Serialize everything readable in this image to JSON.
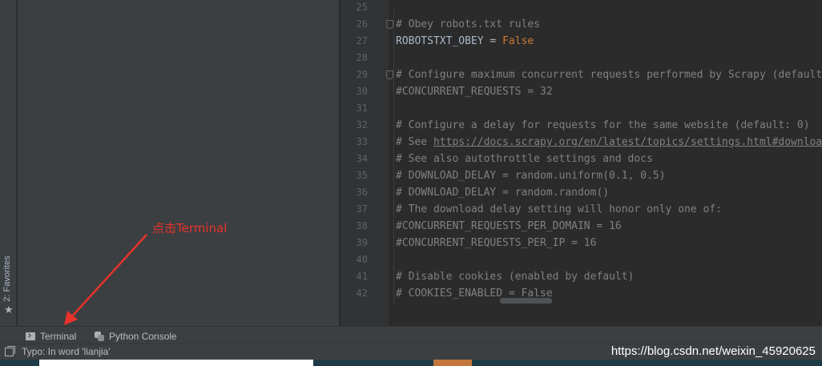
{
  "favorites": {
    "label": "2: Favorites",
    "icon": "star-icon"
  },
  "editor": {
    "lines": [
      {
        "num": "25",
        "text": ""
      },
      {
        "num": "26",
        "text": "# Obey robots.txt rules",
        "fold": true
      },
      {
        "num": "27",
        "text": "ROBOTSTXT_OBEY = ",
        "value": "False",
        "kind": "assign"
      },
      {
        "num": "28",
        "text": ""
      },
      {
        "num": "29",
        "text": "# Configure maximum concurrent requests performed by Scrapy (default",
        "fold": true
      },
      {
        "num": "30",
        "text": "#CONCURRENT_REQUESTS = 32"
      },
      {
        "num": "31",
        "text": ""
      },
      {
        "num": "32",
        "text": "# Configure a delay for requests for the same website (default: 0)"
      },
      {
        "num": "33",
        "text_prefix": "# See ",
        "link": "https://docs.scrapy.org/en/latest/topics/settings.html#download"
      },
      {
        "num": "34",
        "text": "# See also autothrottle settings and docs"
      },
      {
        "num": "35",
        "text": "# DOWNLOAD_DELAY = random.uniform(0.1, 0.5)"
      },
      {
        "num": "36",
        "text": "# DOWNLOAD_DELAY = random.random()"
      },
      {
        "num": "37",
        "text": "# The download delay setting will honor only one of:"
      },
      {
        "num": "38",
        "text": "#CONCURRENT_REQUESTS_PER_DOMAIN = 16"
      },
      {
        "num": "39",
        "text": "#CONCURRENT_REQUESTS_PER_IP = 16"
      },
      {
        "num": "40",
        "text": ""
      },
      {
        "num": "41",
        "text": "# Disable cookies (enabled by default)"
      },
      {
        "num": "42",
        "text": "# COOKIES_ENABLED = False"
      }
    ]
  },
  "tool_tabs": {
    "terminal": {
      "label": "Terminal",
      "icon": "terminal-icon"
    },
    "python_console": {
      "label": "Python Console",
      "icon": "python-icon"
    }
  },
  "status": {
    "message": "Typo: In word 'lianjia'"
  },
  "watermark": "https://blog.csdn.net/weixin_45920625",
  "annotation": {
    "text": "点击Terminal"
  },
  "colors": {
    "annotation_red": "#e8322b",
    "keyword_orange": "#cc7832",
    "comment_gray": "#808080"
  }
}
